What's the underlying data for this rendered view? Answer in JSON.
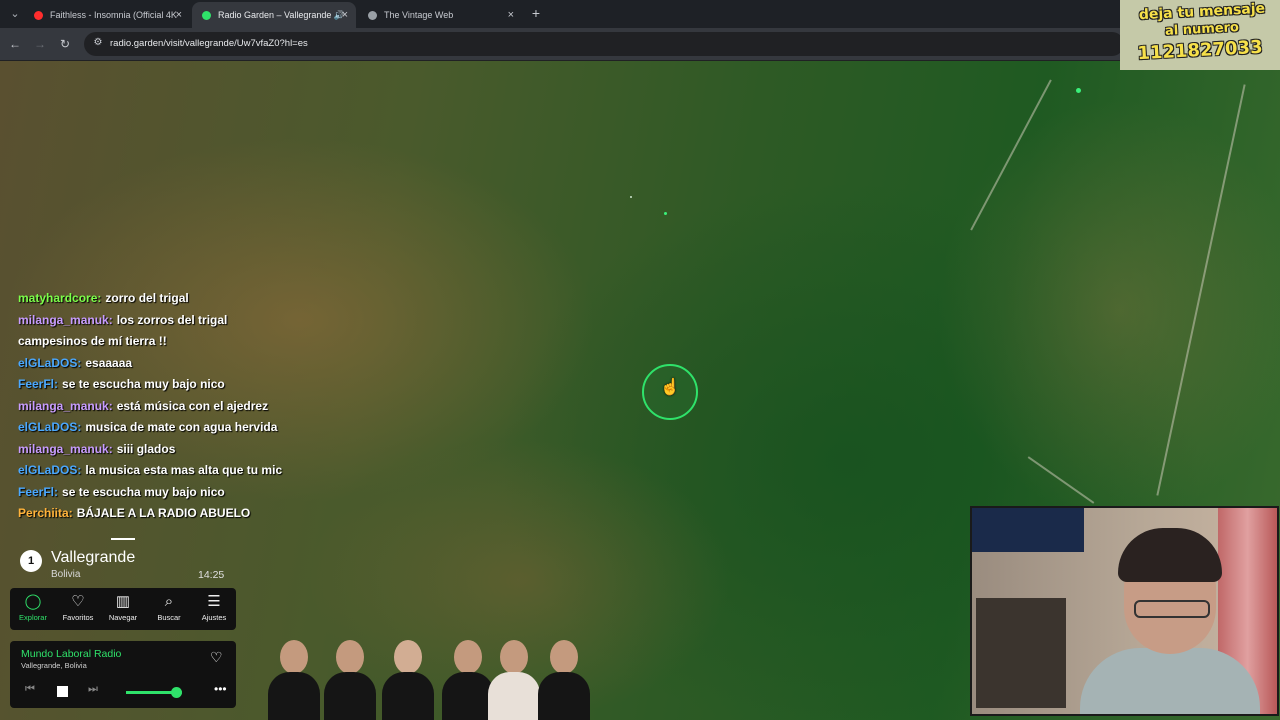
{
  "browser": {
    "tabs": [
      {
        "title": "Faithless - Insomnia (Official 4K",
        "icon_color": "#ff2d2d",
        "active": false
      },
      {
        "title": "Radio Garden – Vallegrande 🔊",
        "icon_color": "#2fe26a",
        "active": true
      },
      {
        "title": "The Vintage Web",
        "icon_color": "#9aa0a6",
        "active": false
      }
    ],
    "tab_menu_icon": "chevron-down-icon",
    "close_glyph": "×",
    "new_tab_glyph": "+",
    "url": "radio.garden/visit/vallegrande/Uw7vfaZ0?hl=es"
  },
  "banner": {
    "line1": "deja tu mensaje",
    "line2": "al numero",
    "line3": "1121827033"
  },
  "chat": [
    {
      "user": "matyhardcore:",
      "color": "#7cff4a",
      "message": "zorro del trigal"
    },
    {
      "user": "milanga_manuk:",
      "color": "#c89cff",
      "message": "los zorros del trigal"
    },
    {
      "user": "",
      "color": "#ffffff",
      "message": "campesinos de mí tierra !!"
    },
    {
      "user": "elGLaDOS:",
      "color": "#4aa8ff",
      "message": "esaaaaa"
    },
    {
      "user": "FeerFl:",
      "color": "#4aa8ff",
      "message": "se te escucha muy bajo nico"
    },
    {
      "user": "milanga_manuk:",
      "color": "#c89cff",
      "message": "está música con el ajedrez"
    },
    {
      "user": "elGLaDOS:",
      "color": "#4aa8ff",
      "message": "musica de mate con agua hervida"
    },
    {
      "user": "milanga_manuk:",
      "color": "#c89cff",
      "message": "siii glados"
    },
    {
      "user": "elGLaDOS:",
      "color": "#4aa8ff",
      "message": "la musica esta mas alta que tu mic"
    },
    {
      "user": "FeerFl:",
      "color": "#4aa8ff",
      "message": "se te escucha muy bajo nico"
    },
    {
      "user": "Perchiita:",
      "color": "#ffb23a",
      "message": "BÁJALE A LA RADIO ABUELO"
    }
  ],
  "station": {
    "count": "1",
    "city": "Vallegrande",
    "country": "Bolivia",
    "time": "14:25"
  },
  "nav": [
    {
      "label": "Explorar",
      "icon": "explore-icon",
      "glyph": "◯",
      "active": true
    },
    {
      "label": "Favoritos",
      "icon": "heart-icon",
      "glyph": "♡",
      "active": false
    },
    {
      "label": "Navegar",
      "icon": "map-icon",
      "glyph": "▥",
      "active": false
    },
    {
      "label": "Buscar",
      "icon": "search-icon",
      "glyph": "⌕",
      "active": false
    },
    {
      "label": "Ajustes",
      "icon": "settings-icon",
      "glyph": "☰",
      "active": false
    }
  ],
  "player": {
    "station_name": "Mundo Laboral Radio",
    "station_location": "Vallegrande, Bolivia",
    "volume": 0.9,
    "accent": "#2fe26a"
  }
}
